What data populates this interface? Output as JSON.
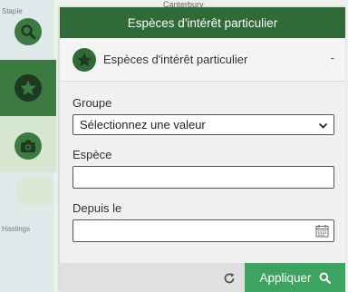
{
  "map": {
    "labels": {
      "top": "Canterbury",
      "left_top": "Staple",
      "left_bottom": "Hastings"
    }
  },
  "toolbar": {
    "items": [
      {
        "icon": "search-icon",
        "active": false
      },
      {
        "icon": "star-icon",
        "active": true
      },
      {
        "icon": "camera-icon",
        "active": false
      }
    ]
  },
  "panel": {
    "title": "Espèces d'intérêt particulier",
    "section_title": "Espèces d'intérêt particulier",
    "collapse_label": "-",
    "fields": {
      "groupe": {
        "label": "Groupe",
        "selected": "Sélectionnez une valeur"
      },
      "espece": {
        "label": "Espèce",
        "value": "",
        "placeholder": ""
      },
      "depuis": {
        "label": "Depuis le",
        "value": ""
      }
    },
    "footer": {
      "apply_label": "Appliquer"
    }
  },
  "colors": {
    "header": "#2f6a37",
    "apply": "#3da45f",
    "active_tool": "#3c7a41"
  }
}
